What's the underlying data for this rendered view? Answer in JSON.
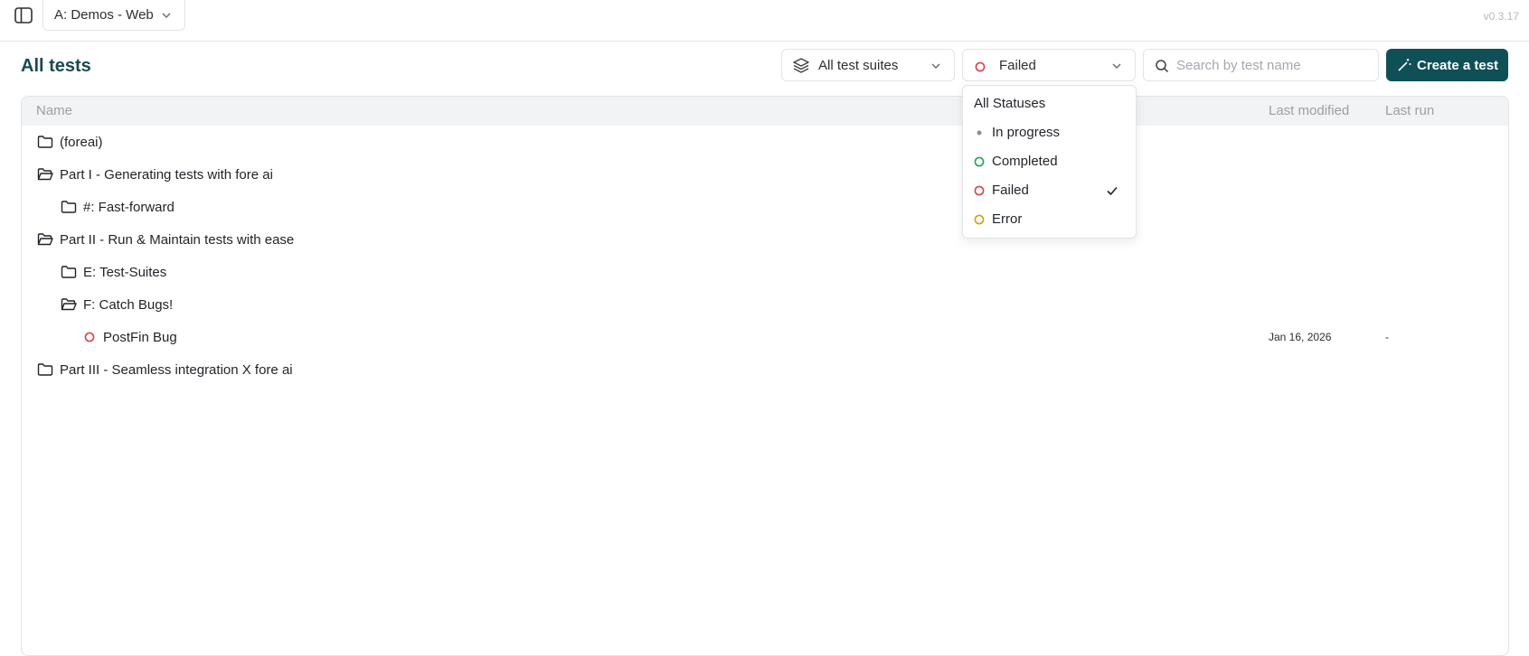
{
  "topbar": {
    "project": "A: Demos - Web",
    "version": "v0.3.17"
  },
  "page": {
    "title": "All tests"
  },
  "filters": {
    "suites_label": "All test suites",
    "status_label": "Failed",
    "search_placeholder": "Search by test name",
    "create_label": "Create a test"
  },
  "table": {
    "columns": {
      "name": "Name",
      "last_modified": "Last modified",
      "last_run": "Last run"
    },
    "rows": [
      {
        "label": "(foreai)",
        "type": "folder-closed",
        "depth": 0
      },
      {
        "label": "Part I - Generating tests with fore ai",
        "type": "folder-open",
        "depth": 0
      },
      {
        "label": "#: Fast-forward",
        "type": "folder-closed",
        "depth": 1
      },
      {
        "label": "Part II - Run & Maintain tests with ease",
        "type": "folder-open",
        "depth": 0
      },
      {
        "label": "E: Test-Suites",
        "type": "folder-closed",
        "depth": 1
      },
      {
        "label": "F: Catch Bugs!",
        "type": "folder-open",
        "depth": 1
      },
      {
        "label": "PostFin Bug",
        "type": "test-failed",
        "depth": 2,
        "last_modified": "Jan 16, 2026",
        "last_run": "-"
      },
      {
        "label": "Part III - Seamless integration X fore ai",
        "type": "folder-closed",
        "depth": 0
      }
    ]
  },
  "status_dropdown": {
    "items": [
      {
        "label": "All Statuses",
        "status": "all"
      },
      {
        "label": "In progress",
        "status": "in-progress"
      },
      {
        "label": "Completed",
        "status": "completed"
      },
      {
        "label": "Failed",
        "status": "failed",
        "selected": true
      },
      {
        "label": "Error",
        "status": "error"
      }
    ]
  },
  "colors": {
    "accent": "#0f4f56",
    "failed": "#d64545",
    "completed": "#2e9e5b",
    "error": "#c9a21a",
    "in_progress": "#8a9096"
  }
}
